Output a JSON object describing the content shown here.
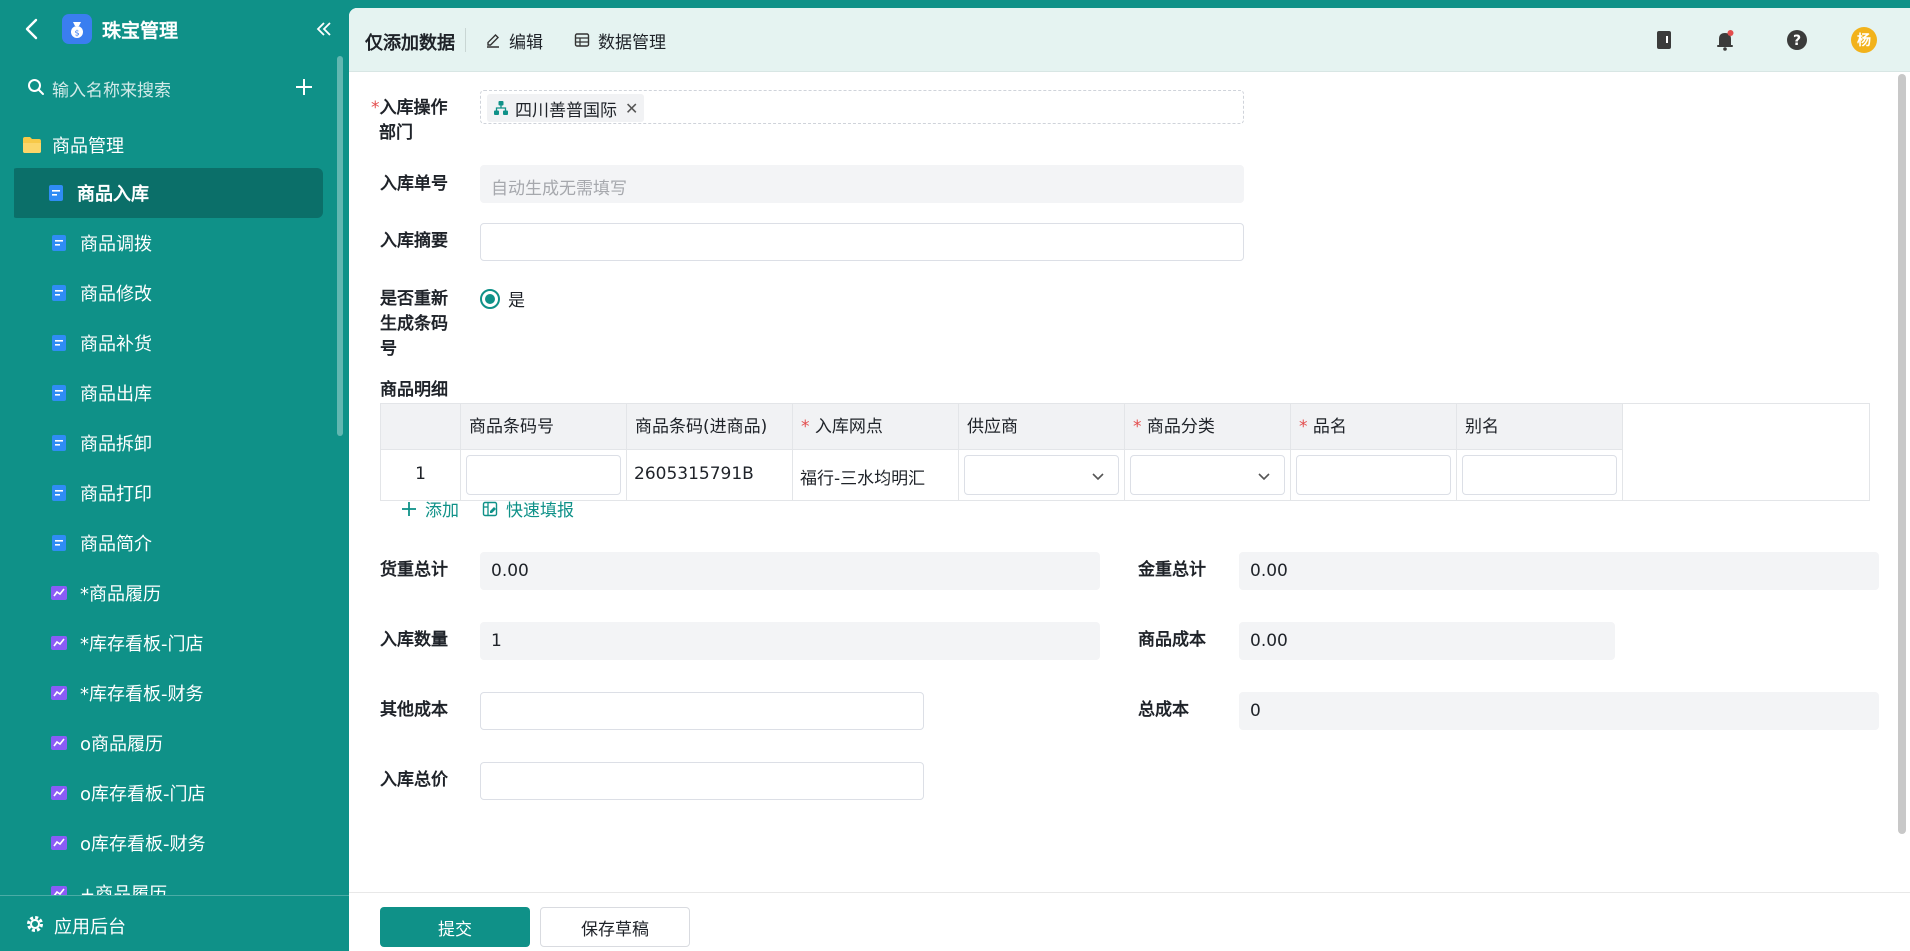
{
  "sidebar": {
    "app_title": "珠宝管理",
    "search_placeholder": "输入名称来搜索",
    "group_label": "商品管理",
    "items": [
      {
        "label": "商品入库",
        "icon": "document-icon",
        "active": true
      },
      {
        "label": "商品调拨",
        "icon": "document-icon"
      },
      {
        "label": "商品修改",
        "icon": "document-icon"
      },
      {
        "label": "商品补货",
        "icon": "document-icon"
      },
      {
        "label": "商品出库",
        "icon": "document-icon"
      },
      {
        "label": "商品拆卸",
        "icon": "document-icon"
      },
      {
        "label": "商品打印",
        "icon": "document-icon"
      },
      {
        "label": "商品简介",
        "icon": "document-icon"
      },
      {
        "label": "*商品履历",
        "icon": "chart-icon"
      },
      {
        "label": "*库存看板-门店",
        "icon": "chart-icon"
      },
      {
        "label": "*库存看板-财务",
        "icon": "chart-icon"
      },
      {
        "label": "o商品履历",
        "icon": "chart-icon"
      },
      {
        "label": "o库存看板-门店",
        "icon": "chart-icon"
      },
      {
        "label": "o库存看板-财务",
        "icon": "chart-icon"
      },
      {
        "label": "+商品履历",
        "icon": "chart-icon"
      }
    ],
    "footer_label": "应用后台"
  },
  "topbar": {
    "title": "仅添加数据",
    "edit_label": "编辑",
    "data_manage_label": "数据管理",
    "avatar_text": "杨"
  },
  "form": {
    "dept_label_line1": "入库操作",
    "dept_label_line2": "部门",
    "dept_value": "四川善普国际",
    "order_no_label": "入库单号",
    "order_no_placeholder": "自动生成无需填写",
    "summary_label": "入库摘要",
    "summary_value": "",
    "regen_label_line1": "是否重新",
    "regen_label_line2": "生成条码",
    "regen_label_line3": "号",
    "regen_option": "是",
    "detail_label": "商品明细",
    "table": {
      "columns": [
        "",
        "商品条码号",
        "商品条码(进商品)",
        "入库网点",
        "供应商",
        "商品分类",
        "品名",
        "别名"
      ],
      "required": [
        false,
        false,
        false,
        true,
        false,
        true,
        true,
        false
      ],
      "rows": [
        {
          "index": "1",
          "barcode": "",
          "barcode_in": "2605315791B",
          "outlet": "福行-三水均明汇",
          "supplier": "",
          "category": "",
          "name": "",
          "alias": ""
        }
      ]
    },
    "add_label": "添加",
    "quick_fill_label": "快速填报",
    "goods_weight_label": "货重总计",
    "goods_weight_value": "0.00",
    "gold_weight_label": "金重总计",
    "gold_weight_value": "0.00",
    "qty_label": "入库数量",
    "qty_value": "1",
    "cost_label": "商品成本",
    "cost_value": "0.00",
    "other_cost_label": "其他成本",
    "other_cost_value": "",
    "total_cost_label": "总成本",
    "total_cost_value": "0",
    "total_price_label": "入库总价"
  },
  "footer": {
    "submit_label": "提交",
    "draft_label": "保存草稿"
  },
  "colors": {
    "brand": "#0f9188",
    "active_item": "#0b6f69",
    "required": "#e34d4d",
    "doc_icon": "#2f8cf5",
    "chart_icon": "#8a5cf6"
  }
}
